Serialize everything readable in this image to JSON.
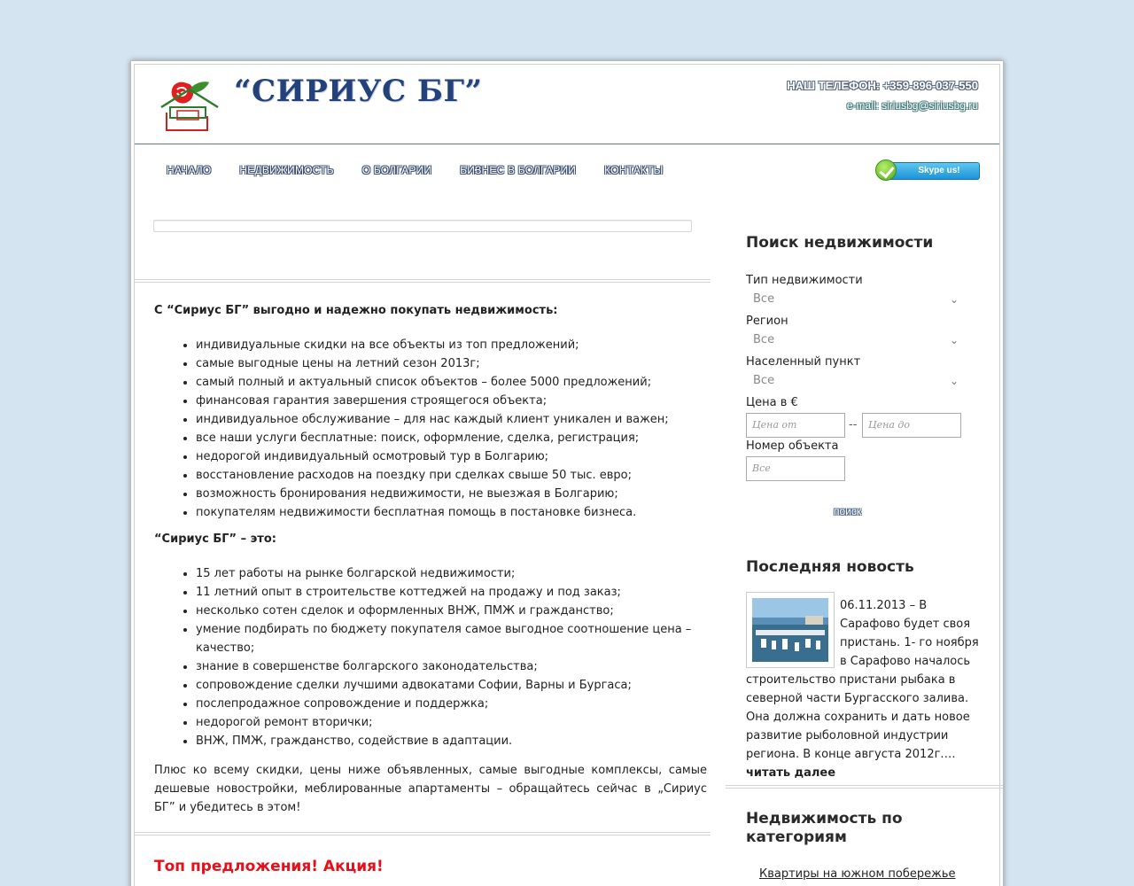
{
  "header": {
    "brand": "“СИРИУС БГ”",
    "phone": "НАШ ТЕЛЕФОН: +359-896-037-550",
    "email": "e-mail: siriusbg@siriusbg.ru"
  },
  "nav": {
    "items": [
      "НАЧАЛО",
      "НЕДВИЖИМОСТЬ",
      "О БОЛГАРИИ",
      "БИЗНЕС В БОЛГАРИИ",
      "КОНТАКТЫ"
    ],
    "skype": "Skype us!"
  },
  "main": {
    "lead1": "С “Сириус БГ” выгодно и надежно покупать недвижимость:",
    "list1": [
      "индивидуальные скидки на все объекты из топ предложений;",
      "самые выгодные цены на летний сезон 2013г;",
      "самый полный и актуальный список объектов – более 5000 предложений;",
      "финансовая гарантия завершения строящегося объекта;",
      "индивидуальное обслуживание – для нас каждый клиент уникален и важен;",
      "все наши услуги бесплатные: поиск, оформление, сделка, регистрация;",
      "недорогой индивидуальный осмотровый тур в Болгарию;",
      "восстановление расходов на поездку при сделках свыше 50 тыс. евро;",
      "возможность бронирования недвижимости, не выезжая в Болгарию;",
      "покупателям недвижимости бесплатная помощь в постановке бизнеса."
    ],
    "lead2": "“Сириус БГ” – это:",
    "list2": [
      "15 лет работы на рынке болгарской недвижимости;",
      "11 летний опыт в строительстве коттеджей на продажу и под заказ;",
      "несколько сотен сделок и оформленных ВНЖ, ПМЖ и гражданство;",
      "умение подбирать по бюджету покупателя самое выгодное соотношение цена – качество;",
      "знание в совершенстве болгарского законодательства;",
      "сопровождение сделки лучшими адвокатами Софии, Варны и Бургаса;",
      "послепродажное сопровождение и поддержка;",
      "недорогой ремонт вторички;",
      "ВНЖ, ПМЖ, гражданство, содействие в адаптации."
    ],
    "closing": "Плюс ко всему скидки, цены ниже объявленных, самые выгодные комплексы, самые дешевые новостройки, меблированные апартаменты – обращайтесь сейчас в „Сириус БГ” и убедитесь в этом!",
    "offers_title": "Топ предложения! Акция!"
  },
  "search": {
    "title": "Поиск недвижимости",
    "type_label": "Тип недвижимости",
    "type_value": "Все",
    "region_label": "Регион",
    "region_value": "Все",
    "locality_label": "Населенный пункт",
    "locality_value": "Все",
    "price_label": "Цена в €",
    "price_from_placeholder": "Цена от",
    "price_sep": "--",
    "price_to_placeholder": "Цена до",
    "number_label": "Номер объекта",
    "number_placeholder": "Все",
    "button": "поиск"
  },
  "news": {
    "title": "Последняя новость",
    "text": "06.11.2013 – В Сарафово будет своя пристань. 1- го ноября в Сарафово началось строительство пристани рыбака в северной части Бургасского залива. Она должна сохранить и дать новое развитие рыболовной индустрии региона. В конце августа 2012г.…",
    "more": "читать далее"
  },
  "categories": {
    "title": "Недвижимость по категориям",
    "first_link": "Квартиры на южном побережье"
  },
  "colors": {
    "background": "#d4e4f1",
    "brand": "#23417b",
    "offers": "#e4111a"
  }
}
